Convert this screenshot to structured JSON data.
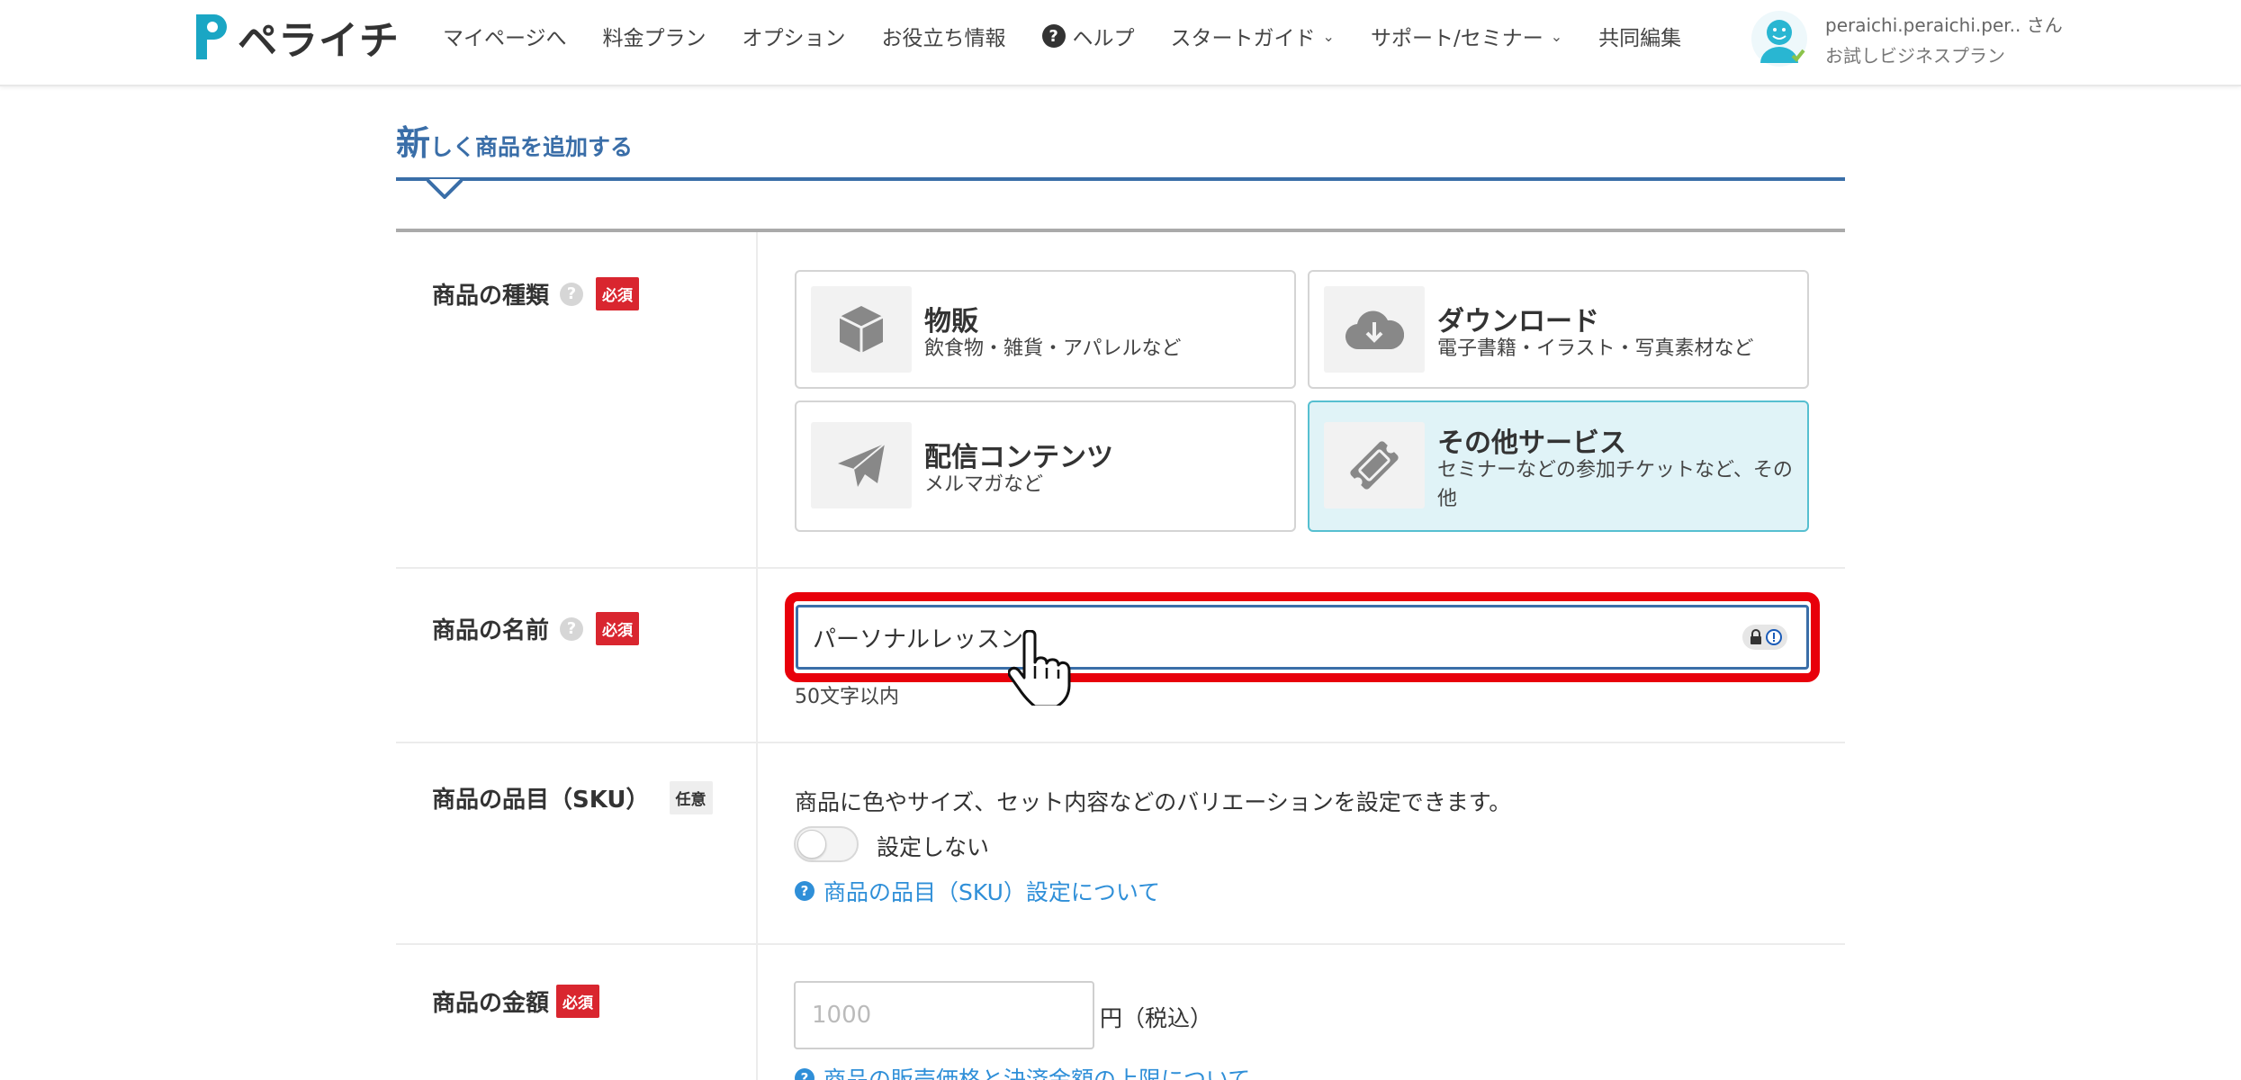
{
  "header": {
    "logo_text": "ペライチ",
    "nav": [
      {
        "label": "マイページへ"
      },
      {
        "label": "料金プラン"
      },
      {
        "label": "オプション"
      },
      {
        "label": "お役立ち情報"
      },
      {
        "label": "ヘルプ"
      },
      {
        "label": "スタートガイド"
      },
      {
        "label": "サポート/セミナー"
      },
      {
        "label": "共同編集"
      }
    ],
    "user": {
      "name": "peraichi.peraichi.per.. さん",
      "plan": "お試しビジネスプラン"
    }
  },
  "page": {
    "title_first": "新",
    "title_rest": "しく商品を追加する"
  },
  "form": {
    "type": {
      "label": "商品の種類",
      "required_badge": "必須",
      "options": [
        {
          "title": "物販",
          "desc": "飲食物・雑貨・アパレルなど",
          "icon": "box-icon",
          "selected": false
        },
        {
          "title": "ダウンロード",
          "desc": "電子書籍・イラスト・写真素材など",
          "icon": "cloud-download-icon",
          "selected": false
        },
        {
          "title": "配信コンテンツ",
          "desc": "メルマガなど",
          "icon": "paper-plane-icon",
          "selected": false
        },
        {
          "title": "その他サービス",
          "desc": "セミナーなどの参加チケットなど、その他",
          "icon": "ticket-icon",
          "selected": true
        }
      ]
    },
    "name": {
      "label": "商品の名前",
      "required_badge": "必須",
      "value": "パーソナルレッスン",
      "hint": "50文字以内"
    },
    "sku": {
      "label": "商品の品目（SKU）",
      "optional_badge": "任意",
      "description": "商品に色やサイズ、セット内容などのバリエーションを設定できます。",
      "toggle_label": "設定しない",
      "toggle_on": false,
      "help_link": "商品の品目（SKU）設定について"
    },
    "price": {
      "label": "商品の金額",
      "required_badge": "必須",
      "placeholder": "1000",
      "unit": "円（税込）",
      "help_link": "商品の販売価格と決済金額の上限について"
    }
  },
  "colors": {
    "accent_blue": "#3a6ea8",
    "required_red": "#d9262f",
    "highlight_red": "#e8000b",
    "selected_card_bg": "#e0f3f7",
    "link_blue": "#2f8fd8"
  }
}
